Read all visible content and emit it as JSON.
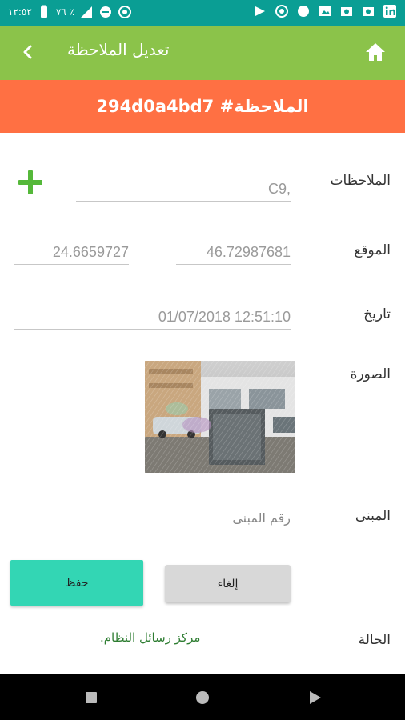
{
  "status_bar": {
    "time": "١٢:٥٢",
    "battery": "٧٦ ٪",
    "network": "LTE",
    "icons": [
      "signal-icon",
      "do-not-disturb-icon",
      "hotspot-icon",
      "flag-icon",
      "record-icon",
      "circle-icon",
      "image-icon",
      "camera-icon",
      "camera-icon",
      "linkedin-icon"
    ]
  },
  "app_bar": {
    "title": "تعديل الملاحظة",
    "back_icon": "chevron-left-icon",
    "home_icon": "home-icon",
    "color": "#8bc34a"
  },
  "banner": {
    "text": "الملاحظة# 294d0a4bd7",
    "color": "#ff7043"
  },
  "form": {
    "notes": {
      "label": "الملاحظات",
      "value": "C9,"
    },
    "location": {
      "label": "الموقع",
      "longitude": "46.72987681",
      "latitude": "24.6659727"
    },
    "date": {
      "label": "تاريخ",
      "value": "01/07/2018 12:51:10"
    },
    "photo": {
      "label": "الصورة"
    },
    "building": {
      "label": "المبنى",
      "placeholder": "رقم المبنى"
    },
    "status": {
      "label": "الحالة",
      "message": "مركز رسائل النظام."
    }
  },
  "buttons": {
    "save": "حفظ",
    "cancel": "إلغاء",
    "save_color": "#33d6b4"
  },
  "nav": {
    "icons": [
      "recents-icon",
      "home-circle-icon",
      "back-triangle-icon"
    ]
  }
}
